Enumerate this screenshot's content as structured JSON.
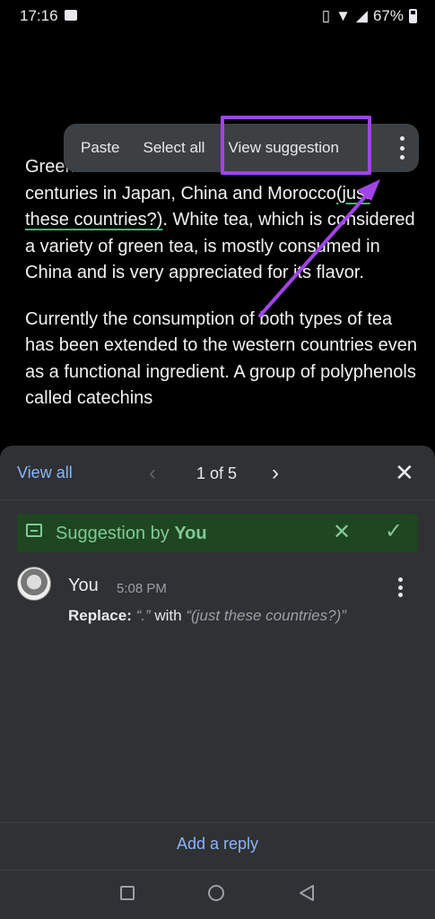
{
  "status_bar": {
    "time": "17:16",
    "battery": "67%"
  },
  "document": {
    "para1": {
      "part1": "Green tea has been c",
      "part2": "centuries in Japan, China and Morocco",
      "inserted1": "(just",
      "inserted2": "these countries?)",
      "part3": ". White tea, which is considered a variety of green tea, is mostly consumed in China and is very appreciated for its flavor."
    },
    "para2": "Currently the consumption of both types of tea has been extended to the western countries even as a functional ingredient. A group of polyphenols called catechins"
  },
  "context_menu": {
    "paste": "Paste",
    "select_all": "Select all",
    "view_suggestion": "View suggestion"
  },
  "annotation": {
    "highlight_color": "#a044e8"
  },
  "sheet": {
    "view_all": "View all",
    "counter": "1 of 5",
    "suggestion_prefix": "Suggestion by ",
    "suggestion_author": "You",
    "comment": {
      "author": "You",
      "time": "5:08 PM",
      "replace_label": "Replace:",
      "from": "“.”",
      "with_word": " with ",
      "to": "“(just these countries?)”"
    },
    "add_reply": "Add a reply"
  },
  "colors": {
    "accent_link": "#8ab4f8",
    "suggestion_bg": "#1e4620",
    "suggestion_fg": "#81c995"
  }
}
